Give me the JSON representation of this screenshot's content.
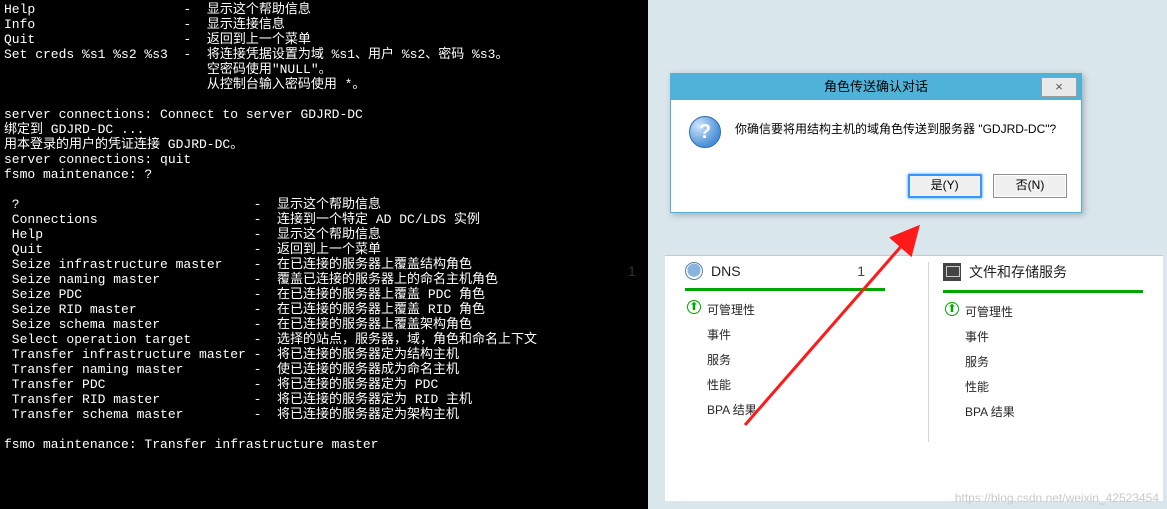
{
  "terminal": {
    "text": "Help                   -  显示这个帮助信息\nInfo                   -  显示连接信息\nQuit                   -  返回到上一个菜单\nSet creds %s1 %s2 %s3  -  将连接凭据设置为域 %s1、用户 %s2、密码 %s3。\n                          空密码使用\"NULL\"。\n                          从控制台输入密码使用 *。\n\nserver connections: Connect to server GDJRD-DC\n绑定到 GDJRD-DC ...\n用本登录的用户的凭证连接 GDJRD-DC。\nserver connections: quit\nfsmo maintenance: ?\n\n ?                              -  显示这个帮助信息\n Connections                    -  连接到一个特定 AD DC/LDS 实例\n Help                           -  显示这个帮助信息\n Quit                           -  返回到上一个菜单\n Seize infrastructure master    -  在已连接的服务器上覆盖结构角色\n Seize naming master            -  覆盖已连接的服务器上的命名主机角色\n Seize PDC                      -  在已连接的服务器上覆盖 PDC 角色\n Seize RID master               -  在已连接的服务器上覆盖 RID 角色\n Seize schema master            -  在已连接的服务器上覆盖架构角色\n Select operation target        -  选择的站点，服务器，域，角色和命名上下文\n Transfer infrastructure master -  将已连接的服务器定为结构主机\n Transfer naming master         -  使已连接的服务器成为命名主机\n Transfer PDC                   -  将已连接的服务器定为 PDC\n Transfer RID master            -  将已连接的服务器定为 RID 主机\n Transfer schema master         -  将已连接的服务器定为架构主机\n\nfsmo maintenance: Transfer infrastructure master"
  },
  "dialog": {
    "title": "角色传送确认对话",
    "close": "×",
    "message": "你确信要将用结构主机的域角色传送到服务器 \"GDJRD-DC\"?",
    "yes": "是(Y)",
    "no": "否(N)"
  },
  "dashboard": {
    "left_prev_count": "1",
    "dns": {
      "title": "DNS",
      "count": "1",
      "items": [
        "可管理性",
        "事件",
        "服务",
        "性能",
        "BPA 结果"
      ]
    },
    "files": {
      "title": "文件和存储服务",
      "items": [
        "可管理性",
        "事件",
        "服务",
        "性能",
        "BPA 结果"
      ]
    }
  },
  "watermark": "https://blog.csdn.net/weixin_42523454"
}
